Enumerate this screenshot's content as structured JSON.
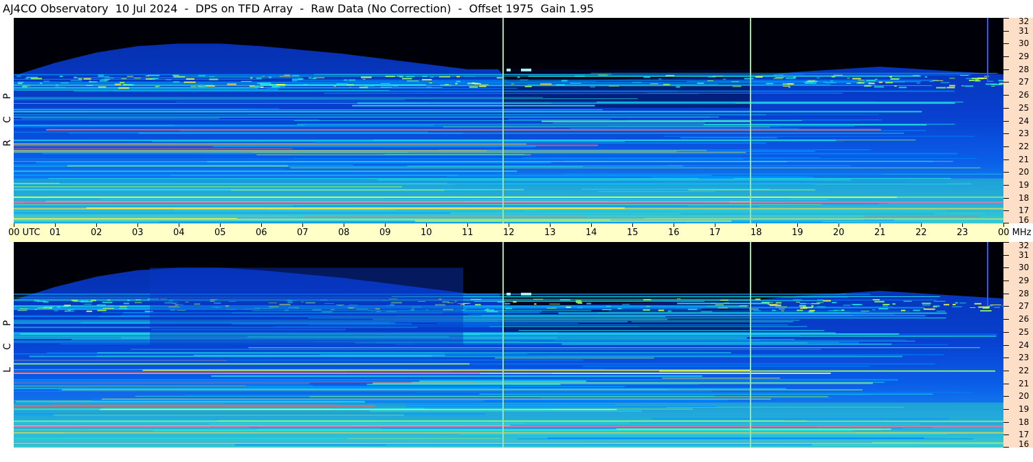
{
  "header": {
    "title": "AJ4CO Observatory  10 Jul 2024  -  DPS on TFD Array  -  Raw Data (No Correction)  -  Offset 1975  Gain 1.95"
  },
  "panels": [
    {
      "id": "rcp",
      "polarization_letters": [
        "R",
        "C",
        "P"
      ]
    },
    {
      "id": "lcp",
      "polarization_letters": [
        "L",
        "C",
        "P"
      ]
    }
  ],
  "time_axis": {
    "labels": [
      "00 UTC",
      "01",
      "02",
      "03",
      "04",
      "05",
      "06",
      "07",
      "08",
      "09",
      "10",
      "11",
      "12",
      "13",
      "14",
      "15",
      "16",
      "17",
      "18",
      "19",
      "20",
      "21",
      "22",
      "23",
      "00 MHz"
    ]
  },
  "chart_data": {
    "type": "heatmap",
    "title": "AJ4CO Observatory  10 Jul 2024  -  DPS on TFD Array  -  Raw Data (No Correction)  -  Offset 1975  Gain 1.95",
    "xlabel": "UTC",
    "ylabel": "MHz",
    "x_range_hours": [
      0,
      24
    ],
    "y_range_mhz": [
      16,
      32
    ],
    "y_ticks": [
      32,
      31,
      30,
      29,
      28,
      27,
      26,
      25,
      24,
      23,
      22,
      21,
      20,
      19,
      18,
      17,
      16
    ],
    "x_ticks": [
      "00 UTC",
      "01",
      "02",
      "03",
      "04",
      "05",
      "06",
      "07",
      "08",
      "09",
      "10",
      "11",
      "12",
      "13",
      "14",
      "15",
      "16",
      "17",
      "18",
      "19",
      "20",
      "21",
      "22",
      "23",
      "00"
    ],
    "panels": [
      "RCP",
      "LCP"
    ],
    "vertical_markers_utc_hours": [
      11.85,
      17.85
    ],
    "ionospheric_cutoff_mhz": {
      "hours": [
        0,
        1,
        2,
        3,
        4,
        5,
        6,
        7,
        8,
        9,
        10,
        11,
        11.85,
        12,
        18,
        19,
        20,
        21,
        22,
        23,
        24
      ],
      "mhz": [
        27.5,
        28.5,
        29.3,
        29.8,
        30.0,
        30.0,
        29.8,
        29.5,
        29.2,
        28.8,
        28.4,
        28.0,
        28.0,
        27.0,
        27.5,
        27.8,
        28.0,
        28.2,
        28.0,
        27.8,
        27.6
      ]
    },
    "colormap": [
      "#000010",
      "#001a80",
      "#0040e0",
      "#0090ff",
      "#20e0e0",
      "#a0ff60",
      "#ffff40",
      "#ff6060"
    ]
  }
}
